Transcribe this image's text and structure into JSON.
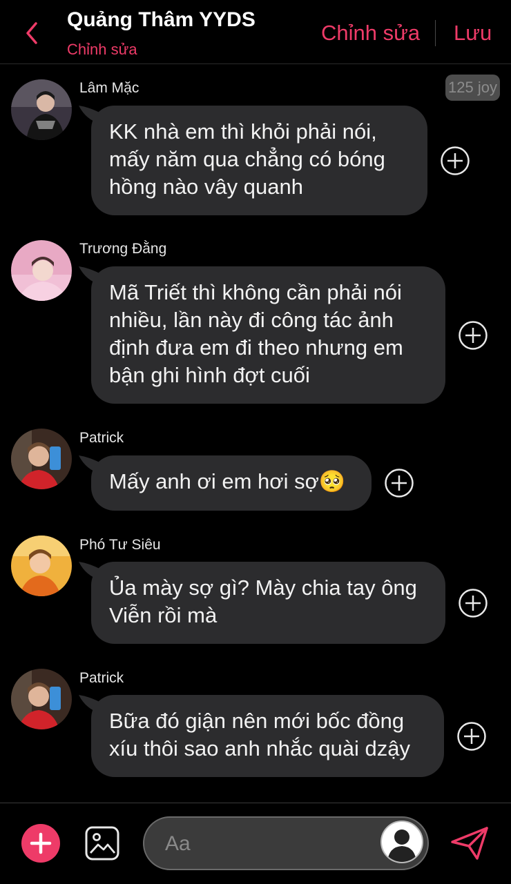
{
  "header": {
    "title": "Quảng Thâm YYDS",
    "subtitle": "Chỉnh sửa",
    "edit_label": "Chỉnh sửa",
    "save_label": "Lưu",
    "back_icon": "chevron-left-icon"
  },
  "joy_badge": "125 joy",
  "messages": [
    {
      "sender": "Lâm Mặc",
      "lines": [
        "KK nhà em thì khỏi phải nói,",
        "mấy năm qua chẳng có bóng",
        "hồng nào vây quanh"
      ]
    },
    {
      "sender": "Trương Đằng",
      "lines": [
        "Mã Triết thì không cần phải nói",
        "nhiều, lần này đi công tác ảnh",
        "định đưa em đi theo nhưng em",
        "bận ghi hình đợt cuối"
      ]
    },
    {
      "sender": "Patrick",
      "lines": [
        "Mấy anh ơi em hơi sợ🥺"
      ]
    },
    {
      "sender": "Phó Tư Siêu",
      "lines": [
        "Ủa mày sợ gì? Mày chia tay ông",
        "Viễn rồi mà"
      ]
    },
    {
      "sender": "Patrick",
      "lines": [
        "Bữa đó giận nên mới bốc đồng",
        "xíu thôi sao anh nhắc quài dzậy"
      ]
    }
  ],
  "composer": {
    "placeholder": "Aa",
    "value": ""
  },
  "colors": {
    "accent": "#ee3b68",
    "bubble": "#2c2c2e",
    "background": "#000000"
  }
}
